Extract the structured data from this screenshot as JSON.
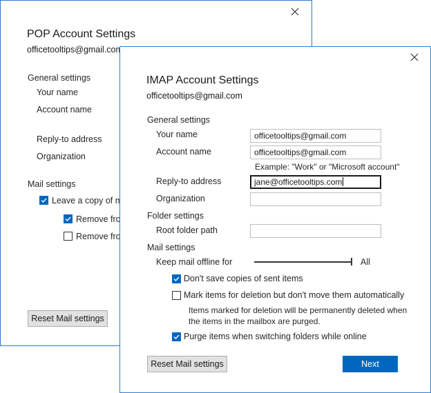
{
  "pop_dialog": {
    "title": "POP Account Settings",
    "email": "officetooltips@gmail.com",
    "general_settings": "General settings",
    "your_name_label": "Your name",
    "account_name_label": "Account name",
    "reply_to_label": "Reply-to address",
    "organization_label": "Organization",
    "mail_settings": "Mail settings",
    "leave_copy_label": "Leave a copy of me",
    "leave_copy_checked": true,
    "remove_from_1_label": "Remove from",
    "remove_from_1_checked": true,
    "remove_from_2_label": "Remove from",
    "remove_from_2_checked": false,
    "reset_button": "Reset Mail settings"
  },
  "imap_dialog": {
    "title": "IMAP Account Settings",
    "email": "officetooltips@gmail.com",
    "general_settings": "General settings",
    "your_name_label": "Your name",
    "your_name_value": "officetooltips@gmail.com",
    "account_name_label": "Account name",
    "account_name_value": "officetooltips@gmail.com",
    "account_name_hint": "Example: \"Work\" or \"Microsoft account\"",
    "reply_to_label": "Reply-to address",
    "reply_to_value": "jane@officetooltips.com",
    "organization_label": "Organization",
    "organization_value": "",
    "folder_settings": "Folder settings",
    "root_folder_label": "Root folder path",
    "root_folder_value": "",
    "mail_settings": "Mail settings",
    "keep_offline_label": "Keep mail offline for",
    "keep_offline_value": "All",
    "dont_save_copies_label": "Don't save copies of sent items",
    "dont_save_copies_checked": true,
    "mark_deletion_label": "Mark items for deletion but don't move them automatically",
    "mark_deletion_checked": false,
    "deletion_note_line1": "Items marked for deletion will be permanently deleted when",
    "deletion_note_line2": "the items in the mailbox are purged.",
    "purge_label": "Purge items when switching folders while online",
    "purge_checked": true,
    "reset_button": "Reset Mail settings",
    "next_button": "Next"
  },
  "icons": {
    "close": "close-icon",
    "check": "check-icon"
  },
  "colors": {
    "window_border": "#2b79d0",
    "accent": "#0067c0",
    "button_bg": "#e1e1e1"
  }
}
